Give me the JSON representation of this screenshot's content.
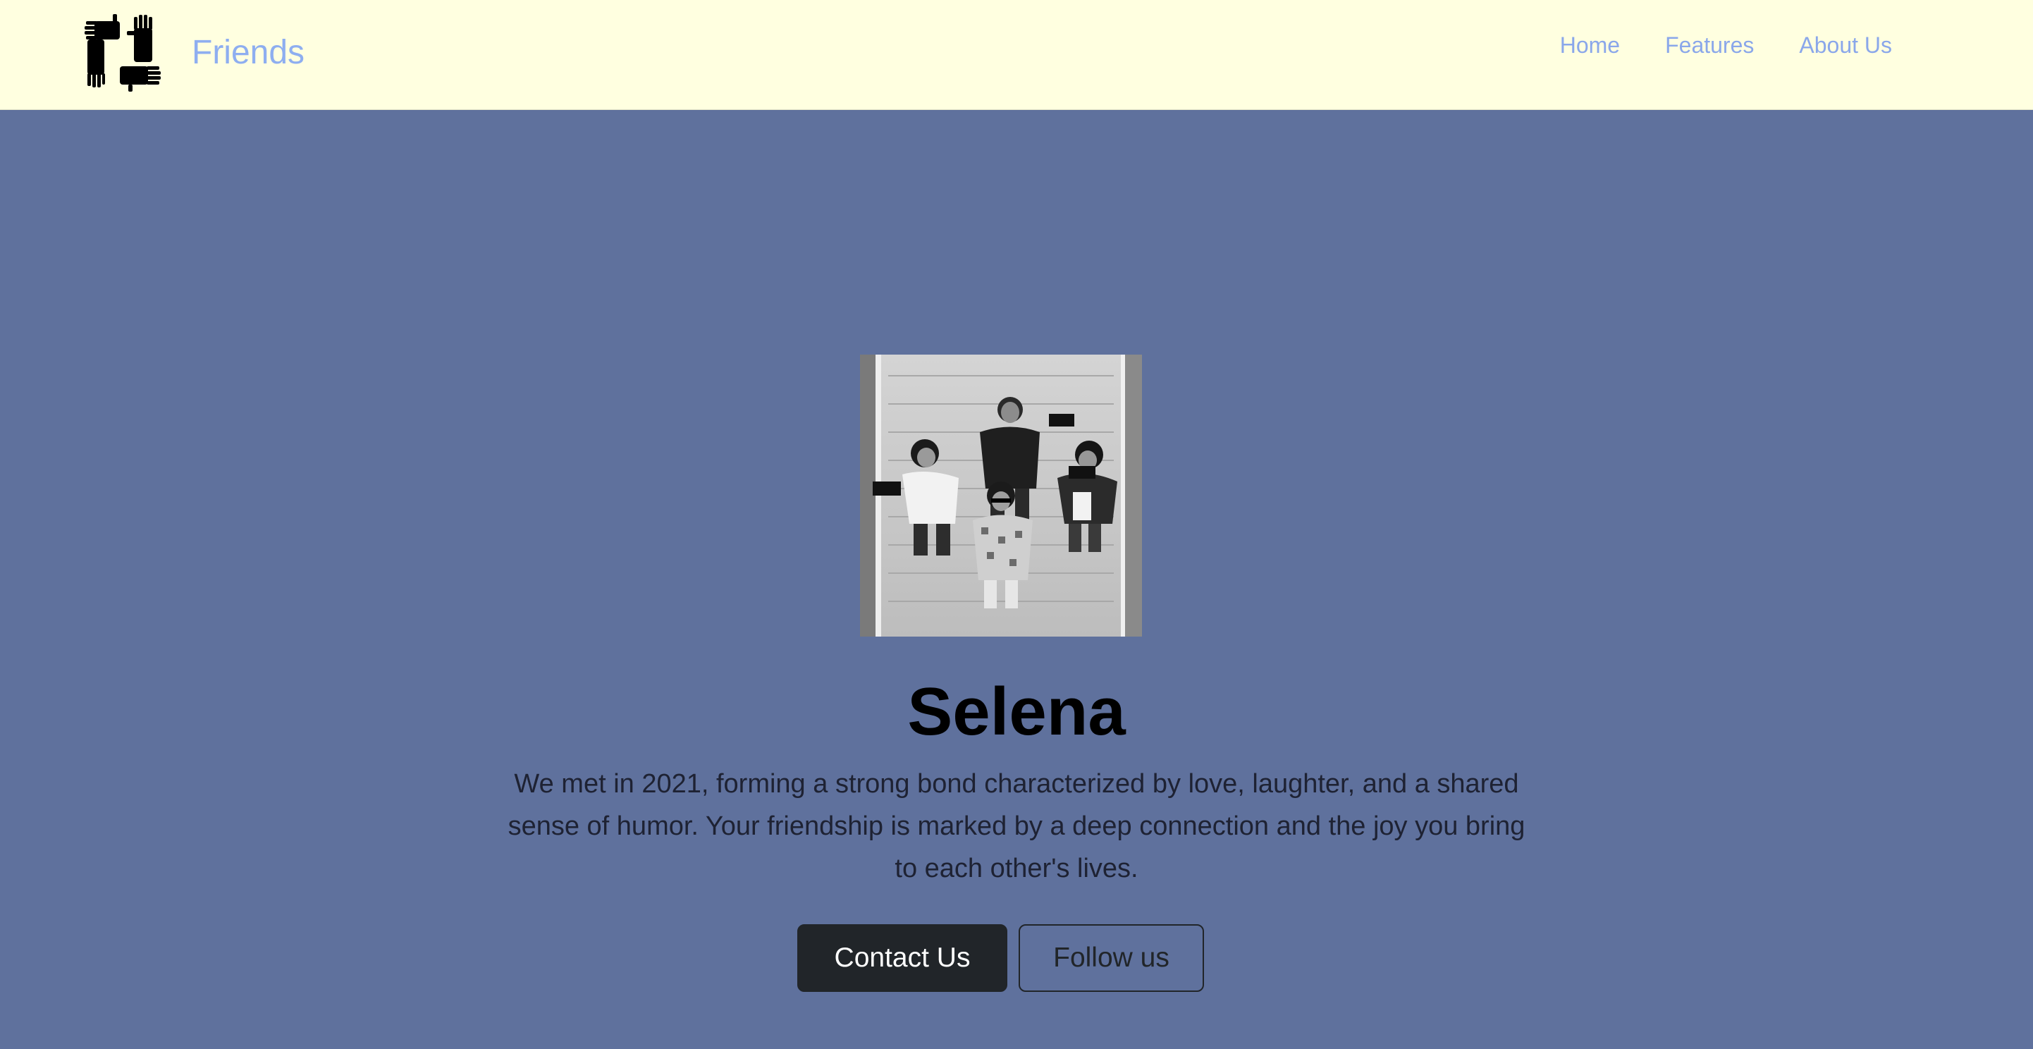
{
  "navbar": {
    "brand_name": "Friends",
    "logo_icon": "four-hands-logo-icon",
    "links": [
      {
        "label": "Home"
      },
      {
        "label": "Features"
      },
      {
        "label": "About Us"
      }
    ]
  },
  "hero": {
    "photo_alt": "SELENA",
    "title": "Selena",
    "lead": "We met in 2021, forming a strong bond characterized by love, laughter, and a shared sense of humor. Your friendship is marked by a deep connection and the joy you bring to each other's lives.",
    "primary_button": "Contact Us",
    "secondary_button": "Follow us"
  },
  "colors": {
    "navbar_bg": "#ffffe0",
    "hero_bg": "#5f719d",
    "link": "#8aa7ea",
    "button_dark": "#212529"
  }
}
